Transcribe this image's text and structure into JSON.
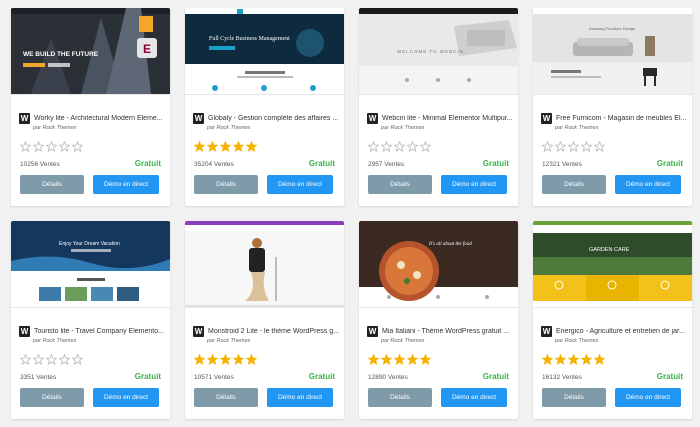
{
  "buttons": {
    "details": "Détails",
    "demo": "Démo en direct"
  },
  "price_color": "#3ab449",
  "themes": [
    {
      "title": "Worky lite - Architectural Modern Eleme...",
      "author": "par Rock Themes",
      "rating": 0,
      "sales": "10256 Ventes",
      "price": "Gratuit",
      "thumb": {
        "headline": "WE BUILD THE FUTURE"
      }
    },
    {
      "title": "Globaly - Gestion complète des affaires ...",
      "author": "par Rock Themes",
      "rating": 5,
      "sales": "35204 Ventes",
      "price": "Gratuit",
      "thumb": {
        "headline": "Full Cycle Business Management"
      }
    },
    {
      "title": "Webcin lite - Minimal Elementor Multipur...",
      "author": "par Rock Themes",
      "rating": 0,
      "sales": "2957 Ventes",
      "price": "Gratuit",
      "thumb": {
        "headline": "WELCOME TO WEBCIN"
      }
    },
    {
      "title": "Free Furnicom - Magasin de meubles El...",
      "author": "par Rock Themes",
      "rating": 0,
      "sales": "12321 Ventes",
      "price": "Gratuit",
      "thumb": {
        "headline": "Amazing Furniture Design"
      }
    },
    {
      "title": "Touristo lite - Travel Company Elemento...",
      "author": "par Rock Themes",
      "rating": 0,
      "sales": "3351 Ventes",
      "price": "Gratuit",
      "thumb": {
        "headline": "Enjoy Your Dream Vacation"
      }
    },
    {
      "title": "Monstroid 2 Lite - le thème WordPress g...",
      "author": "par Rock Themes",
      "rating": 5,
      "sales": "10571 Ventes",
      "price": "Gratuit",
      "thumb": {
        "headline": ""
      }
    },
    {
      "title": "Mia Italiani - Thème WordPress gratuit ...",
      "author": "par Rock Themes",
      "rating": 5,
      "sales": "12890 Ventes",
      "price": "Gratuit",
      "thumb": {
        "headline": "It's all about the food"
      }
    },
    {
      "title": "Energico - Agriculture et entretien de jar...",
      "author": "par Rock Themes",
      "rating": 5,
      "sales": "16132 Ventes",
      "price": "Gratuit",
      "thumb": {
        "headline": "GARDEN CARE"
      }
    }
  ]
}
